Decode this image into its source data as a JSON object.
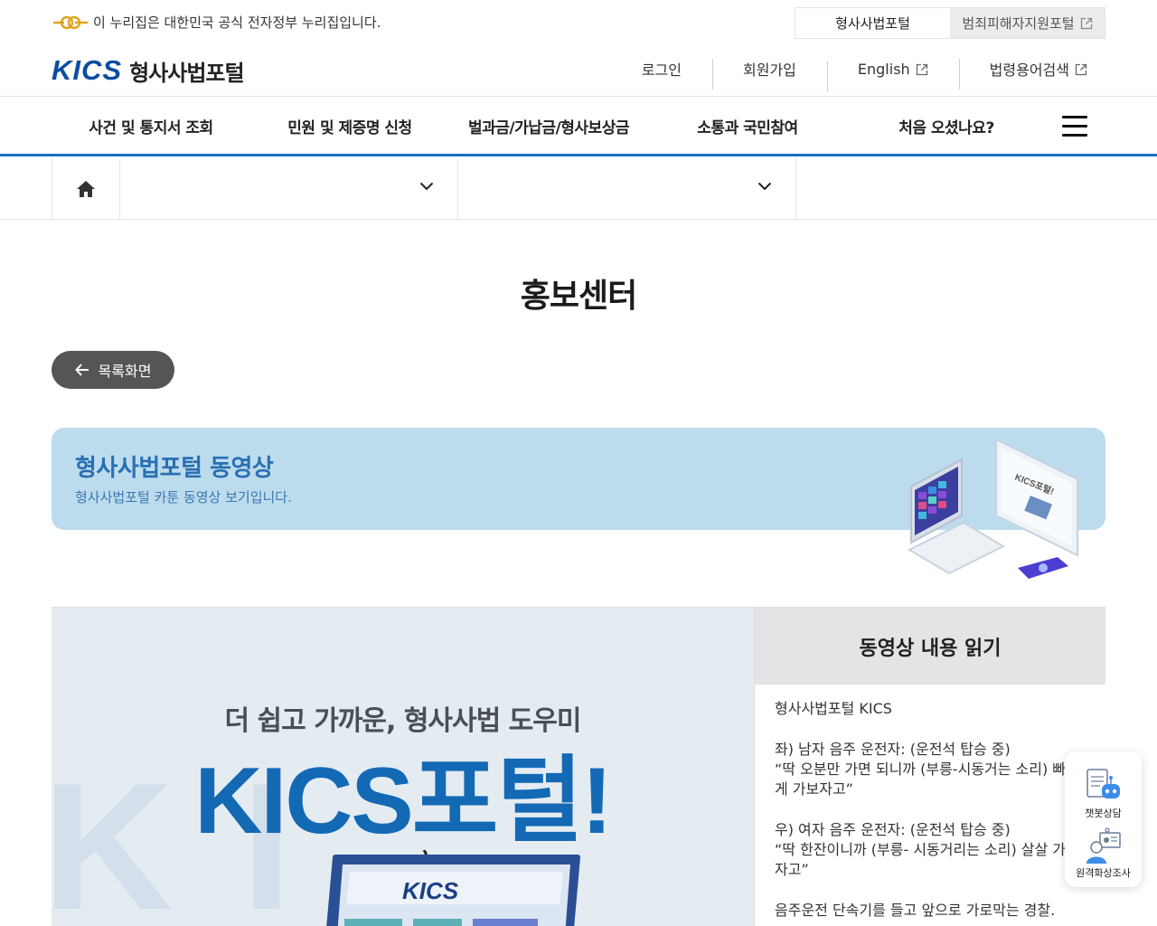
{
  "gov_banner": {
    "text": "이 누리집은 대한민국 공식 전자정부 누리집입니다.",
    "portal_tabs": [
      {
        "label": "형사사법포털"
      },
      {
        "label": "범죄피해자지원포털"
      }
    ]
  },
  "header": {
    "logo_mark": "KICS",
    "logo_text": "형사사법포털",
    "utility": [
      {
        "label": "로그인"
      },
      {
        "label": "회원가입"
      },
      {
        "label": "English"
      },
      {
        "label": "법령용어검색"
      }
    ]
  },
  "gnb": {
    "items": [
      {
        "label": "사건 및 통지서 조회"
      },
      {
        "label": "민원 및 제증명 신청"
      },
      {
        "label": "벌과금/가납금/형사보상금"
      },
      {
        "label": "소통과 국민참여"
      },
      {
        "label": "처음 오셨나요?"
      }
    ]
  },
  "page": {
    "title": "홍보센터",
    "back_label": "목록화면"
  },
  "banner": {
    "title": "형사사법포털 동영상",
    "desc": "형사사법포털 카툰 동영상 보기입니다."
  },
  "video": {
    "subtitle": "더 쉽고 가까운, 형사사법 도우미",
    "headline": "KICS포털!",
    "device_logo": "KICS"
  },
  "reader": {
    "heading": "동영상 내용 읽기",
    "paragraphs": [
      "형사사법포털 KICS",
      "좌) 남자 음주 운전자: (운전석 탑승 중)\n“딱 오분만 가면 되니까 (부릉-시동거는 소리) 빠\n게 가보자고”",
      "우) 여자 음주 운전자: (운전석 탑승 중)\n“딱 한잔이니까 (부릉- 시동거리는 소리) 살살 가\n자고”",
      "음주운전 단속기를 들고 앞으로 가로막는 경찰."
    ]
  },
  "quick_menu": {
    "items": [
      {
        "label": "챗봇상담",
        "icon": "chatbot-icon"
      },
      {
        "label": "원격화상조사",
        "icon": "video-call-icon"
      }
    ]
  },
  "colors": {
    "brand_blue": "#0d4da1",
    "gnb_underline": "#1a6fc4",
    "banner_bg": "#bcdcee",
    "banner_title": "#2a6fb1",
    "back_button": "#555555"
  }
}
